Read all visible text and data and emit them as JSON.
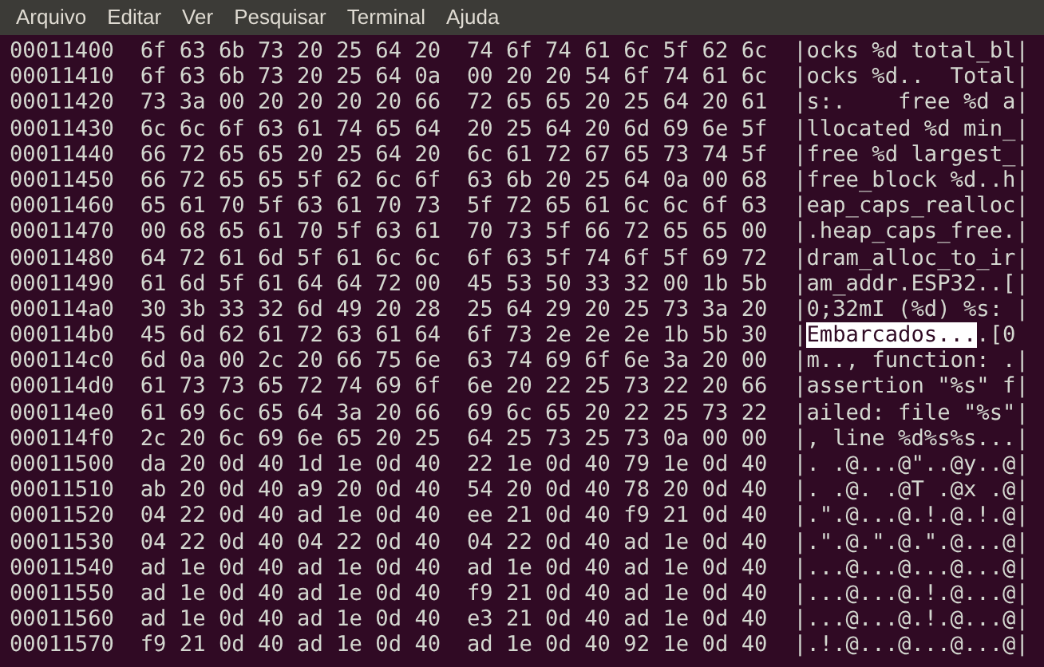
{
  "menu": [
    "Arquivo",
    "Editar",
    "Ver",
    "Pesquisar",
    "Terminal",
    "Ajuda"
  ],
  "rows": [
    {
      "address": "00011400",
      "hex_1": "6f 63 6b 73 20 25 64 20",
      "hex_2": "74 6f 74 61 6c 5f 62 6c",
      "ascii": [
        {
          "text": "|ocks %d total_bl|",
          "selected": false
        }
      ]
    },
    {
      "address": "00011410",
      "hex_1": "6f 63 6b 73 20 25 64 0a",
      "hex_2": "00 20 20 54 6f 74 61 6c",
      "ascii": [
        {
          "text": "|ocks %d..  Total|",
          "selected": false
        }
      ]
    },
    {
      "address": "00011420",
      "hex_1": "73 3a 00 20 20 20 20 66",
      "hex_2": "72 65 65 20 25 64 20 61",
      "ascii": [
        {
          "text": "|s:.    free %d a|",
          "selected": false
        }
      ]
    },
    {
      "address": "00011430",
      "hex_1": "6c 6c 6f 63 61 74 65 64",
      "hex_2": "20 25 64 20 6d 69 6e 5f",
      "ascii": [
        {
          "text": "|llocated %d min_|",
          "selected": false
        }
      ]
    },
    {
      "address": "00011440",
      "hex_1": "66 72 65 65 20 25 64 20",
      "hex_2": "6c 61 72 67 65 73 74 5f",
      "ascii": [
        {
          "text": "|free %d largest_|",
          "selected": false
        }
      ]
    },
    {
      "address": "00011450",
      "hex_1": "66 72 65 65 5f 62 6c 6f",
      "hex_2": "63 6b 20 25 64 0a 00 68",
      "ascii": [
        {
          "text": "|free_block %d..h|",
          "selected": false
        }
      ]
    },
    {
      "address": "00011460",
      "hex_1": "65 61 70 5f 63 61 70 73",
      "hex_2": "5f 72 65 61 6c 6c 6f 63",
      "ascii": [
        {
          "text": "|eap_caps_realloc|",
          "selected": false
        }
      ]
    },
    {
      "address": "00011470",
      "hex_1": "00 68 65 61 70 5f 63 61",
      "hex_2": "70 73 5f 66 72 65 65 00",
      "ascii": [
        {
          "text": "|.heap_caps_free.|",
          "selected": false
        }
      ]
    },
    {
      "address": "00011480",
      "hex_1": "64 72 61 6d 5f 61 6c 6c",
      "hex_2": "6f 63 5f 74 6f 5f 69 72",
      "ascii": [
        {
          "text": "|dram_alloc_to_ir|",
          "selected": false
        }
      ]
    },
    {
      "address": "00011490",
      "hex_1": "61 6d 5f 61 64 64 72 00",
      "hex_2": "45 53 50 33 32 00 1b 5b",
      "ascii": [
        {
          "text": "|am_addr.ESP32..[|",
          "selected": false
        }
      ]
    },
    {
      "address": "000114a0",
      "hex_1": "30 3b 33 32 6d 49 20 28",
      "hex_2": "25 64 29 20 25 73 3a 20",
      "ascii": [
        {
          "text": "|0;32mI (%d) %s: |",
          "selected": false
        }
      ]
    },
    {
      "address": "000114b0",
      "hex_1": "45 6d 62 61 72 63 61 64",
      "hex_2": "6f 73 2e 2e 2e 1b 5b 30",
      "ascii": [
        {
          "text": "|",
          "selected": false
        },
        {
          "text": "Embarcados...",
          "selected": true
        },
        {
          "text": ".[0",
          "selected": false
        }
      ]
    },
    {
      "address": "000114c0",
      "hex_1": "6d 0a 00 2c 20 66 75 6e",
      "hex_2": "63 74 69 6f 6e 3a 20 00",
      "ascii": [
        {
          "text": "|m.., function: .|",
          "selected": false
        }
      ]
    },
    {
      "address": "000114d0",
      "hex_1": "61 73 73 65 72 74 69 6f",
      "hex_2": "6e 20 22 25 73 22 20 66",
      "ascii": [
        {
          "text": "|assertion \"%s\" f|",
          "selected": false
        }
      ]
    },
    {
      "address": "000114e0",
      "hex_1": "61 69 6c 65 64 3a 20 66",
      "hex_2": "69 6c 65 20 22 25 73 22",
      "ascii": [
        {
          "text": "|ailed: file \"%s\"|",
          "selected": false
        }
      ]
    },
    {
      "address": "000114f0",
      "hex_1": "2c 20 6c 69 6e 65 20 25",
      "hex_2": "64 25 73 25 73 0a 00 00",
      "ascii": [
        {
          "text": "|, line %d%s%s...|",
          "selected": false
        }
      ]
    },
    {
      "address": "00011500",
      "hex_1": "da 20 0d 40 1d 1e 0d 40",
      "hex_2": "22 1e 0d 40 79 1e 0d 40",
      "ascii": [
        {
          "text": "|. .@...@\"..@y..@|",
          "selected": false
        }
      ]
    },
    {
      "address": "00011510",
      "hex_1": "ab 20 0d 40 a9 20 0d 40",
      "hex_2": "54 20 0d 40 78 20 0d 40",
      "ascii": [
        {
          "text": "|. .@. .@T .@x .@|",
          "selected": false
        }
      ]
    },
    {
      "address": "00011520",
      "hex_1": "04 22 0d 40 ad 1e 0d 40",
      "hex_2": "ee 21 0d 40 f9 21 0d 40",
      "ascii": [
        {
          "text": "|.\".@...@.!.@.!.@|",
          "selected": false
        }
      ]
    },
    {
      "address": "00011530",
      "hex_1": "04 22 0d 40 04 22 0d 40",
      "hex_2": "04 22 0d 40 ad 1e 0d 40",
      "ascii": [
        {
          "text": "|.\".@.\".@.\".@...@|",
          "selected": false
        }
      ]
    },
    {
      "address": "00011540",
      "hex_1": "ad 1e 0d 40 ad 1e 0d 40",
      "hex_2": "ad 1e 0d 40 ad 1e 0d 40",
      "ascii": [
        {
          "text": "|...@...@...@...@|",
          "selected": false
        }
      ]
    },
    {
      "address": "00011550",
      "hex_1": "ad 1e 0d 40 ad 1e 0d 40",
      "hex_2": "f9 21 0d 40 ad 1e 0d 40",
      "ascii": [
        {
          "text": "|...@...@.!.@...@|",
          "selected": false
        }
      ]
    },
    {
      "address": "00011560",
      "hex_1": "ad 1e 0d 40 ad 1e 0d 40",
      "hex_2": "e3 21 0d 40 ad 1e 0d 40",
      "ascii": [
        {
          "text": "|...@...@.!.@...@|",
          "selected": false
        }
      ]
    },
    {
      "address": "00011570",
      "hex_1": "f9 21 0d 40 ad 1e 0d 40",
      "hex_2": "ad 1e 0d 40 92 1e 0d 40",
      "ascii": [
        {
          "text": "|.!.@...@...@...@|",
          "selected": false
        }
      ]
    }
  ]
}
